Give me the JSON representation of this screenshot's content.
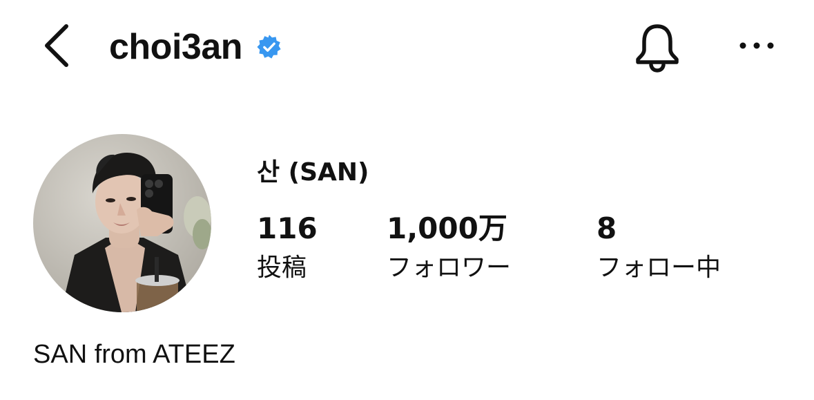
{
  "header": {
    "username": "choi3an",
    "verified": true,
    "icons": {
      "back": "chevron-left-icon",
      "verified": "verified-badge-icon",
      "notifications": "bell-icon",
      "more": "more-horizontal-icon"
    }
  },
  "profile": {
    "display_name": "산 (SAN)",
    "stats": {
      "posts": {
        "value": "116",
        "label": "投稿"
      },
      "followers": {
        "value": "1,000万",
        "label": "フォロワー"
      },
      "following": {
        "value": "8",
        "label": "フォロー中"
      }
    },
    "bio": "SAN from ATEEZ"
  },
  "colors": {
    "text": "#111111",
    "verified_blue": "#3897F0",
    "background": "#FFFFFF"
  }
}
